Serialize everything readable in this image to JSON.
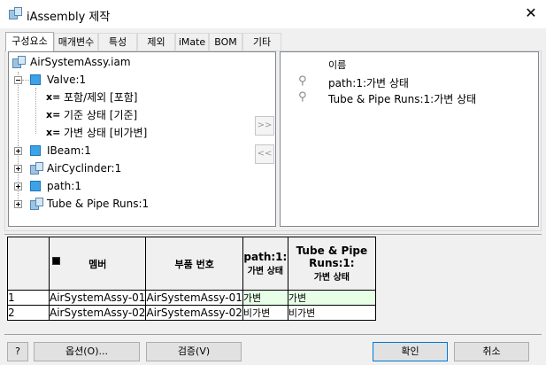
{
  "window": {
    "title": "iAssembly 제작",
    "close_glyph": "✕"
  },
  "tabs": [
    {
      "label": "구성요소",
      "active": true
    },
    {
      "label": "매개변수"
    },
    {
      "label": "특성"
    },
    {
      "label": "제외"
    },
    {
      "label": "iMate"
    },
    {
      "label": "BOM"
    },
    {
      "label": "기타"
    }
  ],
  "tree": {
    "root": "AirSystemAssy.iam",
    "valve": "Valve:1",
    "valve_children": [
      "포함/제외 [포함]",
      "기준 상태 [기준]",
      "가변 상태 [비가변]"
    ],
    "xeq_label": "x=",
    "items": [
      "IBeam:1",
      "AirCyclinder:1",
      "path:1",
      "Tube & Pipe Runs:1"
    ]
  },
  "right_list": {
    "header": "이름",
    "items": [
      "path:1:가변 상태",
      "Tube & Pipe Runs:1:가변 상태"
    ]
  },
  "move_buttons": {
    "add": ">>",
    "remove": "<<"
  },
  "grid": {
    "headers": {
      "member": "멤버",
      "part_number": "부품 번호",
      "col3_line1": "path:1:",
      "col3_line2": "가변 상태",
      "col4_line1": "Tube & Pipe",
      "col4_line2": "Runs:1:",
      "col4_line3": "가변 상태"
    },
    "rows": [
      {
        "num": "1",
        "member": "AirSystemAssy-01",
        "part": "AirSystemAssy-01",
        "c3": "가변",
        "c4": "가변"
      },
      {
        "num": "2",
        "member": "AirSystemAssy-02",
        "part": "AirSystemAssy-02",
        "c3": "비가변",
        "c4": "비가변"
      }
    ]
  },
  "buttons": {
    "help": "?",
    "options": "옵션(O)...",
    "verify": "검증(V)",
    "ok": "확인",
    "cancel": "취소"
  },
  "colors": {
    "accent": "#0078d7",
    "row1_highlight": "#e6ffe6",
    "part_icon": "#3da3e8"
  }
}
